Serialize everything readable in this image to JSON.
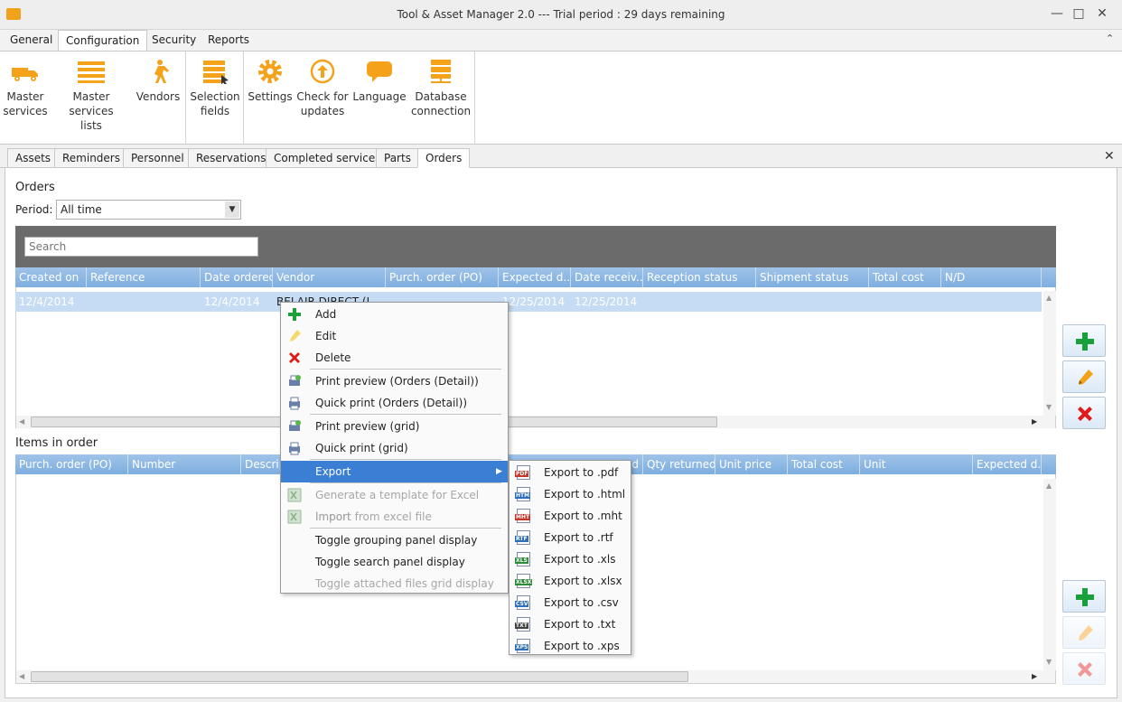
{
  "window": {
    "title": "Tool & Asset Manager 2.0 --- Trial period : 29 days remaining",
    "minimize": "—",
    "maximize": "□",
    "close": "✕"
  },
  "menu_tabs": [
    "General",
    "Configuration",
    "Security",
    "Reports"
  ],
  "ribbon": {
    "master_services": [
      "Master",
      "services"
    ],
    "master_services_lists": [
      "Master services",
      "lists"
    ],
    "vendors": "Vendors",
    "selection_fields": [
      "Selection",
      "fields"
    ],
    "settings": "Settings",
    "check_updates": [
      "Check for",
      "updates"
    ],
    "language": "Language",
    "database_connection": [
      "Database",
      "connection"
    ]
  },
  "doc_tabs": [
    "Assets",
    "Reminders",
    "Personnel",
    "Reservations",
    "Completed services",
    "Parts",
    "Orders"
  ],
  "orders": {
    "heading": "Orders",
    "period_label": "Period:",
    "period_value": "All time",
    "search_placeholder": "Search",
    "columns": [
      "Created on",
      "Reference",
      "Date ordered",
      "Vendor",
      "Purch. order (PO)",
      "Expected d...",
      "Date receiv...",
      "Reception status",
      "Shipment status",
      "Total cost",
      "N/D"
    ],
    "rows": [
      {
        "created_on": "12/4/2014",
        "reference": "",
        "date_ordered": "12/4/2014",
        "vendor": "BELAIR DIRECT (L",
        "po": "",
        "expected": "12/25/2014",
        "received": "12/25/2014"
      }
    ]
  },
  "items": {
    "heading": "Items in order",
    "columns_left": [
      "Purch. order (PO)",
      "Number",
      "Descrip"
    ],
    "columns_right": [
      "...d",
      "Qty returned",
      "Unit price",
      "Total cost",
      "Unit",
      "Expected d..."
    ]
  },
  "context_menu": {
    "add": "Add",
    "edit": "Edit",
    "delete": "Delete",
    "print_preview_detail": "Print preview (Orders (Detail))",
    "quick_print_detail": "Quick print (Orders (Detail))",
    "print_preview_grid": "Print preview (grid)",
    "quick_print_grid": "Quick print (grid)",
    "export": "Export",
    "generate_template": "Generate a template for Excel import",
    "import_excel": "Import from excel file",
    "toggle_grouping": "Toggle grouping panel display",
    "toggle_search": "Toggle search panel display",
    "toggle_attached": "Toggle attached files grid display"
  },
  "export_menu": [
    {
      "label": "Export to .pdf",
      "icon": "PDF",
      "color": "#c0392b"
    },
    {
      "label": "Export to .html",
      "icon": "HTM",
      "color": "#2e6fb8"
    },
    {
      "label": "Export to .mht",
      "icon": "MHT",
      "color": "#c0392b"
    },
    {
      "label": "Export to .rtf",
      "icon": "RTF",
      "color": "#2e6fb8"
    },
    {
      "label": "Export to .xls",
      "icon": "XLS",
      "color": "#2e8b3c"
    },
    {
      "label": "Export to .xlsx",
      "icon": "XLSX",
      "color": "#2e8b3c"
    },
    {
      "label": "Export to .csv",
      "icon": "CSV",
      "color": "#2e6fb8"
    },
    {
      "label": "Export to .txt",
      "icon": "TXT",
      "color": "#444444"
    },
    {
      "label": "Export to .xps",
      "icon": "XPS",
      "color": "#2e6fb8"
    }
  ],
  "colors": {
    "accent_orange": "#f4a21a",
    "grid_header": "#8bb6e4",
    "selection": "#c5dcf4",
    "add_green": "#1aa03a",
    "delete_red": "#e01a1a"
  }
}
